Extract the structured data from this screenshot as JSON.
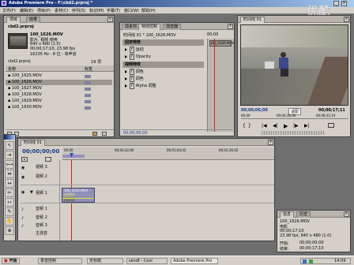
{
  "titlebar": {
    "title": "Adobe Premiere Pro - F:\\cbd2.prproj *",
    "menu": [
      "文件(F)",
      "编辑(E)",
      "项目(P)",
      "素材(C)",
      "序列(S)",
      "标记(M)",
      "字幕(T)",
      "窗口(W)",
      "帮助(H)"
    ],
    "min": "_",
    "max": "□",
    "close": "×"
  },
  "watermark": "优酷",
  "project": {
    "tabs": [
      "项目",
      "效果"
    ],
    "clip_name": "100_1626.MOV",
    "clip_type": "影片, 视频 使用",
    "clip_size": "640 x 480 (1.0)",
    "clip_duration": "00;00;17;10, 23.98 fps",
    "clip_audio": "16235 Hz - 8 位 - 单声道",
    "project_name": "cbd2.prproj",
    "item_count": "19 项",
    "col_name": "名称",
    "col_label": "标签",
    "items": [
      "100_1625.MOV",
      "100_1626.MOV",
      "100_1627.MOV",
      "100_1628.MOV",
      "100_1629.MOV",
      "100_1630.MOV"
    ],
    "selected_index": 1
  },
  "effects": {
    "tabs": [
      "源素材",
      "特效控制",
      "混音器"
    ],
    "header_left": "时间线 01 * 100_1626.MOV",
    "header_timecode": "00;00",
    "clip_label": "100_1626.MOV",
    "rows": [
      {
        "label": "固定特效",
        "header": true
      },
      {
        "label": "运动",
        "icon": true
      },
      {
        "label": "Opacity",
        "icon": true
      },
      {
        "label": "视频特效",
        "header": true
      },
      {
        "label": "调色",
        "icon": true
      },
      {
        "label": "调色",
        "icon": true
      },
      {
        "label": "Alpha 调整",
        "icon": true
      }
    ],
    "time_bottom": "00;00;00;00"
  },
  "monitor": {
    "tabs": [
      "时间线 01"
    ],
    "timecode_left": "00;00;06;00",
    "scale": "适配",
    "timecode_right": "00;00;17;11",
    "ruler": [
      "00;00",
      "00;04;16;00",
      "00;08;32;16"
    ]
  },
  "timeline": {
    "tab": "时间线 01",
    "timecode": "00;00;00;00",
    "ruler": [
      "00;00",
      "00;00;32;00",
      "00;01;04;02",
      "00;01;36;02"
    ],
    "tracks": [
      "视频 3",
      "视频 2",
      "视频 1",
      "音频 1",
      "音频 2",
      "音频 3",
      "主混音"
    ],
    "clip_label": "100_1626.MOV"
  },
  "info": {
    "tabs": [
      "信息",
      "历史"
    ],
    "clip_name": "100_1626.MOV",
    "type": "电影",
    "duration": "00;00;17;10",
    "rate": "23.98 fps, 640 x 480 (1.0)",
    "start_label": "开始:",
    "end_label": "结束:",
    "start": "00;00;00;00",
    "end": "00;00;17;10"
  },
  "taskbar": {
    "start": "开始",
    "buttons": [
      "录音控制",
      "无标题",
      "sendf - Cool",
      "Adobe Premiere Pro"
    ],
    "clock": "14:09"
  }
}
